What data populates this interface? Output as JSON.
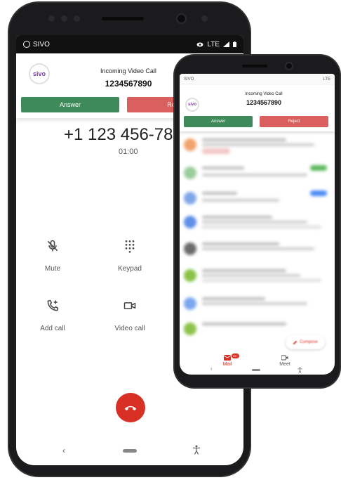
{
  "main_phone": {
    "status_bar": {
      "app_name": "SIVO",
      "network": "LTE"
    },
    "notification": {
      "logo_text": "sivo",
      "title": "Incoming Video Call",
      "number": "1234567890",
      "answer_label": "Answer",
      "reject_label": "Reject"
    },
    "call": {
      "number": "+1 123 456-78",
      "timer": "01:00"
    },
    "controls": [
      {
        "label": "Mute",
        "icon": "mic-off-icon"
      },
      {
        "label": "Keypad",
        "icon": "dialpad-icon"
      },
      {
        "label": "Add call",
        "icon": "add-call-icon"
      },
      {
        "label": "Video call",
        "icon": "videocam-icon"
      }
    ],
    "nav": {
      "back": "‹"
    }
  },
  "second_phone": {
    "status_bar": {
      "app_name": "SIVO",
      "network": "LTE"
    },
    "notification": {
      "logo_text": "sivo",
      "title": "Incoming Video Call",
      "number": "1234567890",
      "answer_label": "Answer",
      "reject_label": "Reject"
    },
    "compose_label": "Compose",
    "tabs": [
      {
        "label": "Mail",
        "badge": "99+",
        "icon": "mail-icon"
      },
      {
        "label": "Meet",
        "icon": "video-icon"
      }
    ],
    "nav": {
      "back": "‹"
    }
  },
  "colors": {
    "answer": "#3f8a5a",
    "reject": "#d9605e",
    "end_call": "#d93025",
    "brand": "#7b3fa0"
  }
}
